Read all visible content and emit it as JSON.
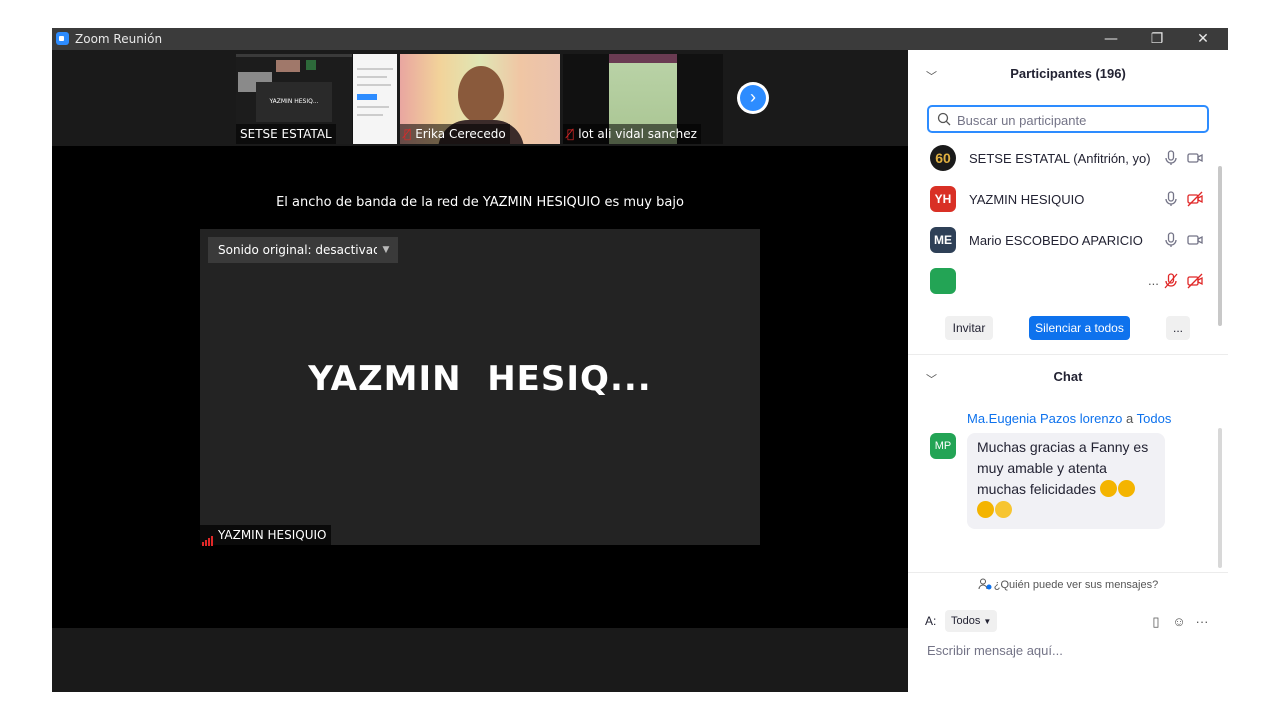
{
  "window": {
    "title": "Zoom Reunión",
    "minimize_glyph": "—",
    "restore_glyph": "❐",
    "close_glyph": "✕"
  },
  "video_strip": {
    "thumbnails": [
      {
        "name": "SETSE ESTATAL",
        "muted": false,
        "screen_text": "YAZMIN HESIQ..."
      },
      {
        "name": "Erika Cerecedo",
        "muted": true
      },
      {
        "name": "lot ali vidal sanchez",
        "muted": true
      }
    ],
    "next_glyph": "›"
  },
  "main_video": {
    "bandwidth_message": "El ancho de banda de la red de YAZMIN HESIQUIO es muy bajo",
    "sound_dropdown": "Sonido original: desactivado",
    "sound_dropdown_arrow": "▼",
    "display_name_large": "YAZMIN  HESIQ...",
    "tile_label": "YAZMIN HESIQUIO"
  },
  "participants": {
    "collapse_glyph": "﹀",
    "header": "Participantes (196)",
    "search_placeholder": "Buscar un participante",
    "list": [
      {
        "initials": "60",
        "name": "SETSE ESTATAL (Anfitrión, yo)",
        "avatar_color": "#1a1a1a",
        "mic_muted": false,
        "video_off": false
      },
      {
        "initials": "YH",
        "name": "YAZMIN HESIQUIO",
        "avatar_color": "#d93025",
        "mic_muted": false,
        "video_off": true
      },
      {
        "initials": "ME",
        "name": "Mario ESCOBEDO APARICIO",
        "avatar_color": "#2e4057",
        "mic_muted": false,
        "video_off": false
      },
      {
        "initials": "",
        "name": "",
        "avatar_color": "#23a455",
        "mic_muted": true,
        "video_off": true,
        "more": "..."
      }
    ],
    "invite_label": "Invitar",
    "mute_all_label": "Silenciar a todos",
    "more_label": "..."
  },
  "chat": {
    "collapse_glyph": "﹀",
    "header": "Chat",
    "messages": [
      {
        "initials": "MP",
        "avatar_color": "#23a455",
        "sender": "Ma.Eugenia Pazos lorenzo",
        "to_word": "a",
        "recipient": "Todos",
        "text": "Muchas gracias a Fanny es muy amable y atenta muchas felicidades"
      }
    ],
    "who_can_see": "¿Quién puede ver sus mensajes?",
    "to_label": "A:",
    "to_value": "Todos",
    "input_placeholder": "Escribir mensaje aquí...",
    "more_glyph": "···"
  },
  "colors": {
    "accent": "#0e72ed",
    "muted_red": "#e02828",
    "stage_bg": "#000000",
    "tile_bg": "#232323"
  }
}
